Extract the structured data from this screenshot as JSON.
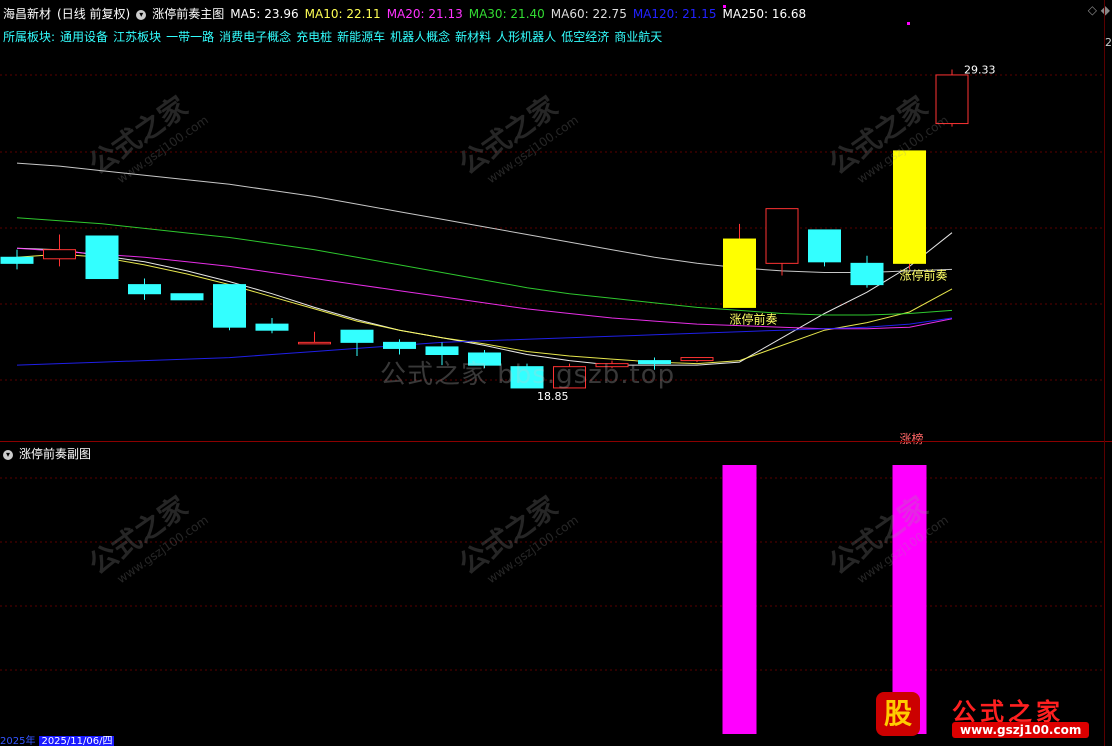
{
  "header": {
    "stock_name": "海昌新材",
    "mode": "(日线 前复权)",
    "indicator_name": "涨停前奏主图",
    "ma": [
      {
        "label": "MA5: 23.96",
        "color": "#ffffff"
      },
      {
        "label": "MA10: 22.11",
        "color": "#ffff55"
      },
      {
        "label": "MA20: 21.13",
        "color": "#ff33ff"
      },
      {
        "label": "MA30: 21.40",
        "color": "#33dd33"
      },
      {
        "label": "MA60: 22.75",
        "color": "#dddddd"
      },
      {
        "label": "MA120: 21.15",
        "color": "#2222ff"
      },
      {
        "label": "MA250: 16.68",
        "color": "#ffffff"
      }
    ]
  },
  "sector": {
    "label": "所属板块:",
    "items": [
      "通用设备",
      "江苏板块",
      "一带一路",
      "消费电子概念",
      "充电桩",
      "新能源车",
      "机器人概念",
      "新材料",
      "人形机器人",
      "低空经济",
      "商业航天"
    ]
  },
  "sub_panel": {
    "title": "涨停前奏副图"
  },
  "watermark": {
    "center_text": "公式之家 bbs.gszb.top",
    "brand": "公式之家",
    "url": "www.gszj100.com"
  },
  "logo": {
    "badge": "股",
    "title": "公式之家",
    "url": "www.gszj100.com"
  },
  "footer": {
    "date_left": "2025年",
    "date_current": "2025/11/06/四"
  },
  "right": {
    "marker": "2"
  },
  "chart_data": [
    {
      "type": "candlestick",
      "title": "涨停前奏主图",
      "ylim": [
        17.4,
        30.3
      ],
      "candles": [
        {
          "o": 23.15,
          "c": 22.95,
          "h": 23.4,
          "l": 22.75
        },
        {
          "o": 23.1,
          "c": 23.4,
          "h": 23.9,
          "l": 22.85
        },
        {
          "o": 23.85,
          "c": 22.45,
          "h": 23.85,
          "l": 22.45
        },
        {
          "o": 22.25,
          "c": 21.95,
          "h": 22.45,
          "l": 21.75
        },
        {
          "o": 21.95,
          "c": 21.75,
          "h": 21.95,
          "l": 21.75
        },
        {
          "o": 22.25,
          "c": 20.85,
          "h": 22.25,
          "l": 20.75
        },
        {
          "o": 20.95,
          "c": 20.75,
          "h": 21.15,
          "l": 20.65
        },
        {
          "o": 20.35,
          "c": 20.35,
          "h": 20.7,
          "l": 20.35
        },
        {
          "o": 20.75,
          "c": 20.35,
          "h": 20.75,
          "l": 19.9
        },
        {
          "o": 20.35,
          "c": 20.15,
          "h": 20.45,
          "l": 19.95
        },
        {
          "o": 20.2,
          "c": 19.95,
          "h": 20.35,
          "l": 19.6
        },
        {
          "o": 20.0,
          "c": 19.6,
          "h": 20.1,
          "l": 19.5
        },
        {
          "o": 19.55,
          "c": 18.85,
          "h": 19.65,
          "l": 18.85
        },
        {
          "o": 18.85,
          "c": 19.55,
          "h": 19.65,
          "l": 18.85
        },
        {
          "o": 19.55,
          "c": 19.65,
          "h": 19.75,
          "l": 19.5
        },
        {
          "o": 19.75,
          "c": 19.65,
          "h": 19.85,
          "l": 19.45
        },
        {
          "o": 19.75,
          "c": 19.85,
          "h": 19.85,
          "l": 19.7
        },
        {
          "o": 21.5,
          "c": 23.75,
          "h": 24.25,
          "l": 21.5
        },
        {
          "o": 22.95,
          "c": 24.75,
          "h": 24.75,
          "l": 22.55
        },
        {
          "o": 24.05,
          "c": 23.0,
          "h": 24.05,
          "l": 22.85
        },
        {
          "o": 22.95,
          "c": 22.25,
          "h": 23.2,
          "l": 22.15
        },
        {
          "o": 22.95,
          "c": 26.65,
          "h": 26.65,
          "l": 22.75
        },
        {
          "o": 27.55,
          "c": 29.15,
          "h": 29.33,
          "l": 27.45
        }
      ],
      "limit_up_days": [
        17,
        21
      ],
      "annotations": [
        {
          "text": "涨停前奏",
          "index": 17
        },
        {
          "text": "涨停前奏",
          "index": 21
        },
        {
          "text": "29.33",
          "index": 22,
          "kind": "high"
        },
        {
          "text": "18.85",
          "index": 12,
          "kind": "low"
        }
      ],
      "series": [
        {
          "name": "MA5",
          "color": "#ffffff",
          "values": [
            23.45,
            23.4,
            23.2,
            23.0,
            22.7,
            22.35,
            21.95,
            21.5,
            21.1,
            20.75,
            20.5,
            20.25,
            19.95,
            19.75,
            19.6,
            19.6,
            19.6,
            19.7,
            20.5,
            21.3,
            22.0,
            22.85,
            23.96
          ]
        },
        {
          "name": "MA10",
          "color": "#ffff55",
          "values": [
            23.15,
            23.25,
            23.15,
            22.9,
            22.6,
            22.25,
            21.85,
            21.45,
            21.05,
            20.75,
            20.5,
            20.3,
            20.05,
            19.9,
            19.8,
            19.7,
            19.65,
            19.75,
            20.25,
            20.75,
            21.0,
            21.35,
            22.11
          ]
        },
        {
          "name": "MA20",
          "color": "#ff33ff",
          "values": [
            23.45,
            23.35,
            23.25,
            23.15,
            23.0,
            22.85,
            22.65,
            22.45,
            22.25,
            22.05,
            21.85,
            21.65,
            21.45,
            21.3,
            21.15,
            21.05,
            20.95,
            20.9,
            20.85,
            20.8,
            20.8,
            20.85,
            21.13
          ]
        },
        {
          "name": "MA30",
          "color": "#33dd33",
          "values": [
            24.45,
            24.35,
            24.25,
            24.1,
            23.95,
            23.8,
            23.6,
            23.4,
            23.15,
            22.9,
            22.65,
            22.4,
            22.15,
            21.95,
            21.8,
            21.65,
            21.5,
            21.4,
            21.3,
            21.25,
            21.25,
            21.3,
            21.4
          ]
        },
        {
          "name": "MA60",
          "color": "#dddddd",
          "values": [
            26.25,
            26.15,
            26.0,
            25.85,
            25.7,
            25.55,
            25.35,
            25.15,
            24.9,
            24.65,
            24.4,
            24.15,
            23.9,
            23.65,
            23.4,
            23.15,
            22.95,
            22.8,
            22.7,
            22.65,
            22.65,
            22.7,
            22.75
          ]
        },
        {
          "name": "MA120",
          "color": "#2222ff",
          "values": [
            19.6,
            19.65,
            19.7,
            19.75,
            19.8,
            19.85,
            19.95,
            20.05,
            20.15,
            20.25,
            20.35,
            20.4,
            20.45,
            20.5,
            20.55,
            20.6,
            20.65,
            20.7,
            20.75,
            20.8,
            20.85,
            20.95,
            21.15
          ]
        }
      ]
    },
    {
      "type": "bar",
      "title": "涨停前奏副图",
      "values": [
        0,
        0,
        0,
        0,
        0,
        0,
        0,
        0,
        0,
        0,
        0,
        0,
        0,
        0,
        0,
        0,
        0,
        1,
        0,
        0,
        0,
        1,
        0
      ],
      "color": "#ff00ff",
      "tag": "涨榜"
    }
  ]
}
